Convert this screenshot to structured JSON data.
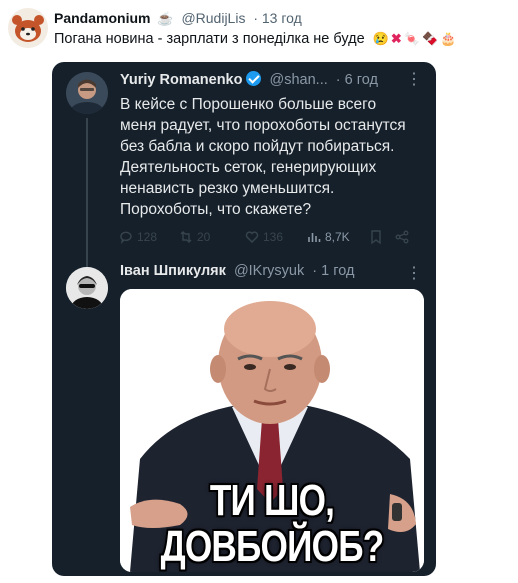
{
  "outer_post": {
    "author_name": "Pandamonium",
    "author_handle": "@RudijLis",
    "time": "· 13 год",
    "text": "Погана новина - зарплати з понеділка не буде",
    "emojis": [
      "crying-face",
      "cross-mark",
      "candy",
      "chocolate-bar",
      "cake"
    ]
  },
  "quoted_tweet": {
    "author_name": "Yuriy Romanenko",
    "author_handle": "@shan...",
    "time": "· 6 год",
    "body_lines": [
      "В кейсе с Порошенко больше всего",
      "меня радует, что порохоботы останутся",
      "без бабла и скоро пойдут побираться.",
      "Деятельность сеток, генерирующих",
      "ненависть резко уменьшится.",
      "Порохоботы, что скажете?"
    ],
    "actions": {
      "replies": "128",
      "retweets": "20",
      "likes": "136",
      "views": "8,7K"
    }
  },
  "reply_tweet": {
    "author_name": "Іван Шпикуляк",
    "author_handle": "@IKrysyuk",
    "time": "· 1 год",
    "meme_caption_line1": "ТИ ШО,",
    "meme_caption_line2": "ДОВБОЙОБ?"
  },
  "colors": {
    "dark_bg": "#15202b",
    "accent": "#1d9bf0",
    "text_light": "#e7e9ea",
    "text_muted": "#8b98a5"
  }
}
